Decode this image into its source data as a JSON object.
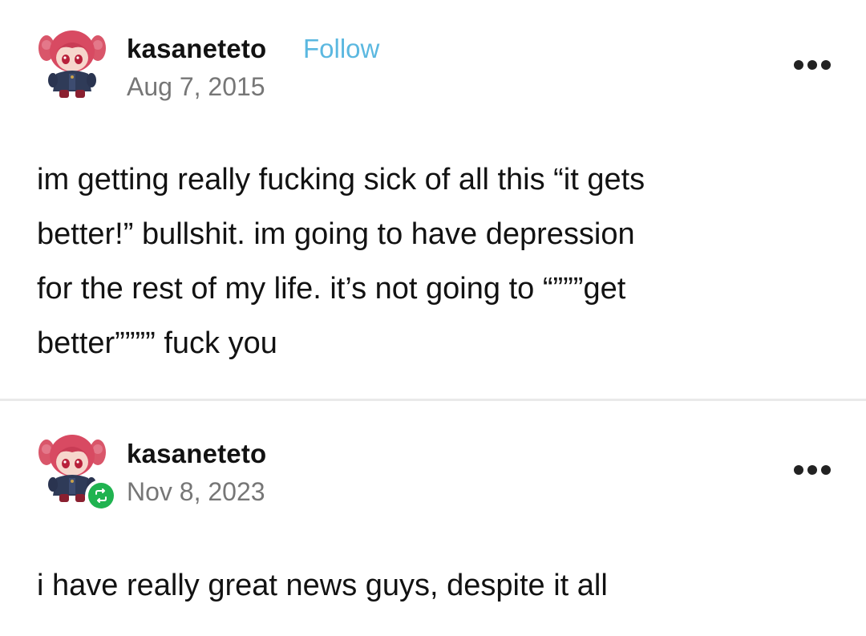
{
  "posts": [
    {
      "username": "kasaneteto",
      "follow_label": "Follow",
      "date": "Aug 7, 2015",
      "more_icon": "more-horizontal-icon",
      "avatar": "user-avatar",
      "body_lines": [
        "im getting really fucking sick of all this “it gets",
        "better!” bullshit. im going to have depression",
        "for the rest of my life. it’s not going to “”””get",
        "better”””” fuck you"
      ]
    },
    {
      "username": "kasaneteto",
      "date": "Nov 8, 2023",
      "more_icon": "more-horizontal-icon",
      "avatar": "user-avatar",
      "badge_icon": "reblog-icon",
      "body_lines": [
        "i have really great news guys, despite it all"
      ]
    }
  ],
  "colors": {
    "follow": "#5bb8e0",
    "date": "#767676",
    "text": "#121212",
    "reblog_badge": "#20b350",
    "divider": "#e9e9e9"
  }
}
